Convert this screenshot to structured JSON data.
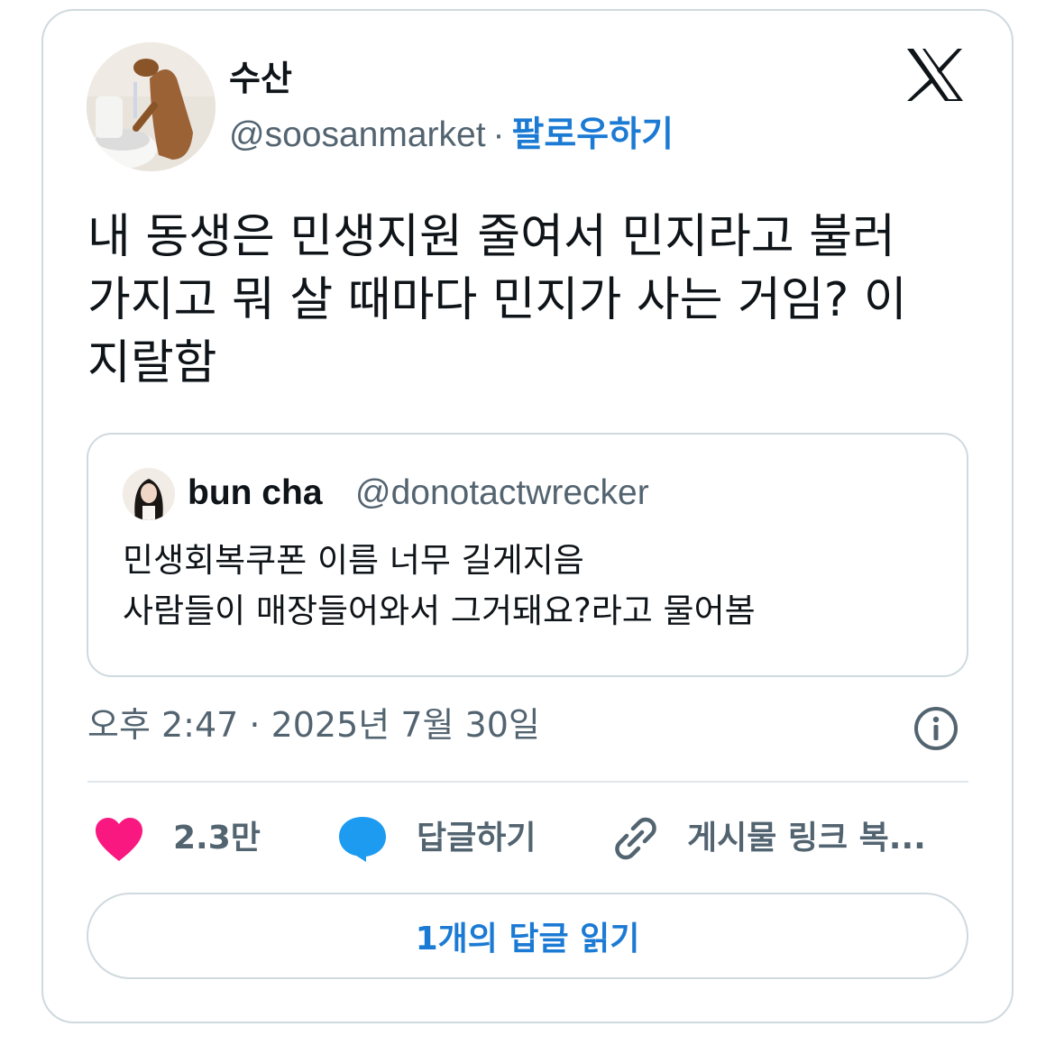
{
  "author": {
    "display_name": "수산",
    "handle": "@soosanmarket",
    "separator": "·",
    "follow_label": "팔로우하기"
  },
  "tweet": {
    "text": "내 동생은 민생지원 줄여서 민지라고 불러\n가지고 뭐 살 때마다 민지가 사는 거임? 이\n지랄함"
  },
  "quoted": {
    "display_name": "bun cha",
    "handle": "@donotactwrecker",
    "text": "민생회복쿠폰 이름 너무 길게지음\n사람들이 매장들어와서 그거돼요?라고 물어봄"
  },
  "meta": {
    "timestamp": "오후 2:47 · 2025년 7월 30일"
  },
  "actions": {
    "like_count": "2.3만",
    "reply_label": "답글하기",
    "copy_link_label": "게시물 링크 복...",
    "read_replies_label": "1개의 답글 읽기"
  },
  "icons": {
    "logo": "x-logo-icon",
    "info": "info-icon",
    "like": "heart-icon",
    "reply": "speech-bubble-icon",
    "link": "link-icon"
  },
  "colors": {
    "accent": "#1b7ad3",
    "heart": "#f91880",
    "reply": "#1d9bf0",
    "secondary_text": "#536471",
    "border": "#cfd9de"
  }
}
